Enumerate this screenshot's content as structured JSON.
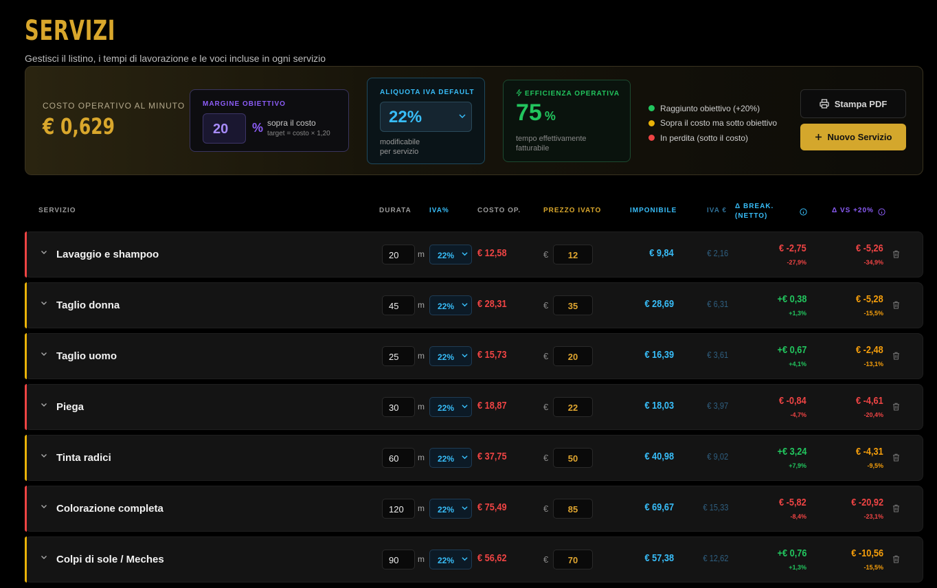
{
  "page": {
    "title": "SERVIZI",
    "subtitle": "Gestisci il listino, i tempi di lavorazione e le voci incluse in ogni servizio"
  },
  "summary": {
    "costo_label": "COSTO OPERATIVO AL MINUTO",
    "costo_value": "€ 0,629",
    "margine": {
      "label": "MARGINE OBIETTIVO",
      "value": "20",
      "unit": "%",
      "desc": "sopra il costo",
      "hint": "target = costo × 1,20"
    },
    "iva": {
      "label": "ALIQUOTA IVA DEFAULT",
      "value": "22%",
      "desc1": "modificabile",
      "desc2": "per servizio"
    },
    "efficienza": {
      "label": "EFFICIENZA OPERATIVA",
      "value": "75",
      "unit": "%",
      "desc1": "tempo effettivamente",
      "desc2": "fatturabile"
    },
    "legend": [
      {
        "label": "Raggiunto obiettivo (+20%)",
        "color": "#22c55e"
      },
      {
        "label": "Sopra il costo ma sotto obiettivo",
        "color": "#eab308"
      },
      {
        "label": "In perdita (sotto il costo)",
        "color": "#ef4444"
      }
    ],
    "btn_pdf": "Stampa PDF",
    "btn_new": "Nuovo Servizio"
  },
  "table": {
    "headers": {
      "servizio": "SERVIZIO",
      "durata": "DURATA",
      "iva": "IVA%",
      "costo": "COSTO OP.",
      "prezzo": "PREZZO IVATO",
      "imponibile": "IMPONIBILE",
      "iva_eur": "IVA €",
      "break1": "Δ BREAK.",
      "break2": "(NETTO)",
      "vs": "Δ VS +20%"
    },
    "rows": [
      {
        "name": "Lavaggio e shampoo",
        "durata": "20",
        "unit": "m",
        "iva": "22%",
        "costo": "€ 12,58",
        "eur": "€",
        "prezzo": "12",
        "imponibile": "€ 9,84",
        "iva_eur": "€ 2,16",
        "break": "€ -2,75",
        "break_pct": "-27,9%",
        "vs": "€ -5,26",
        "vs_pct": "-34,9%",
        "status": "#ef4444",
        "break_color": "#ef4444",
        "vs_color": "#ef4444"
      },
      {
        "name": "Taglio donna",
        "durata": "45",
        "unit": "m",
        "iva": "22%",
        "costo": "€ 28,31",
        "eur": "€",
        "prezzo": "35",
        "imponibile": "€ 28,69",
        "iva_eur": "€ 6,31",
        "break": "+€ 0,38",
        "break_pct": "+1,3%",
        "vs": "€ -5,28",
        "vs_pct": "-15,5%",
        "status": "#eab308",
        "break_color": "#22c55e",
        "vs_color": "#f59e0b"
      },
      {
        "name": "Taglio uomo",
        "durata": "25",
        "unit": "m",
        "iva": "22%",
        "costo": "€ 15,73",
        "eur": "€",
        "prezzo": "20",
        "imponibile": "€ 16,39",
        "iva_eur": "€ 3,61",
        "break": "+€ 0,67",
        "break_pct": "+4,1%",
        "vs": "€ -2,48",
        "vs_pct": "-13,1%",
        "status": "#eab308",
        "break_color": "#22c55e",
        "vs_color": "#f59e0b"
      },
      {
        "name": "Piega",
        "durata": "30",
        "unit": "m",
        "iva": "22%",
        "costo": "€ 18,87",
        "eur": "€",
        "prezzo": "22",
        "imponibile": "€ 18,03",
        "iva_eur": "€ 3,97",
        "break": "€ -0,84",
        "break_pct": "-4,7%",
        "vs": "€ -4,61",
        "vs_pct": "-20,4%",
        "status": "#ef4444",
        "break_color": "#ef4444",
        "vs_color": "#ef4444"
      },
      {
        "name": "Tinta radici",
        "durata": "60",
        "unit": "m",
        "iva": "22%",
        "costo": "€ 37,75",
        "eur": "€",
        "prezzo": "50",
        "imponibile": "€ 40,98",
        "iva_eur": "€ 9,02",
        "break": "+€ 3,24",
        "break_pct": "+7,9%",
        "vs": "€ -4,31",
        "vs_pct": "-9,5%",
        "status": "#eab308",
        "break_color": "#22c55e",
        "vs_color": "#f59e0b"
      },
      {
        "name": "Colorazione completa",
        "durata": "120",
        "unit": "m",
        "iva": "22%",
        "costo": "€ 75,49",
        "eur": "€",
        "prezzo": "85",
        "imponibile": "€ 69,67",
        "iva_eur": "€ 15,33",
        "break": "€ -5,82",
        "break_pct": "-8,4%",
        "vs": "€ -20,92",
        "vs_pct": "-23,1%",
        "status": "#ef4444",
        "break_color": "#ef4444",
        "vs_color": "#ef4444"
      },
      {
        "name": "Colpi di sole / Meches",
        "durata": "90",
        "unit": "m",
        "iva": "22%",
        "costo": "€ 56,62",
        "eur": "€",
        "prezzo": "70",
        "imponibile": "€ 57,38",
        "iva_eur": "€ 12,62",
        "break": "+€ 0,76",
        "break_pct": "+1,3%",
        "vs": "€ -10,56",
        "vs_pct": "-15,5%",
        "status": "#eab308",
        "break_color": "#22c55e",
        "vs_color": "#f59e0b"
      }
    ]
  }
}
